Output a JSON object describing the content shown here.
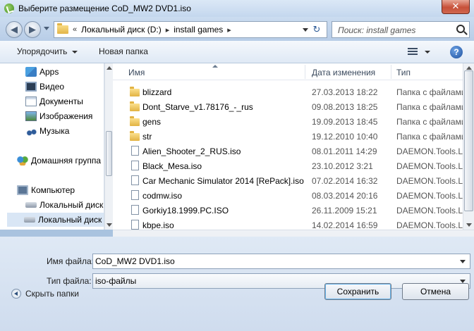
{
  "window": {
    "title": "Выберите размещение CoD_MW2 DVD1.iso",
    "close_glyph": "✕"
  },
  "nav_buttons": {
    "back": "◀",
    "forward": "▶"
  },
  "address": {
    "prefix": "«",
    "crumbs": [
      "Локальный диск (D:)",
      "install games"
    ],
    "separator": "▸",
    "refresh_glyph": "↻"
  },
  "search": {
    "placeholder": "Поиск: install games"
  },
  "toolbar": {
    "organize": "Упорядочить",
    "new_folder": "Новая папка",
    "help": "?"
  },
  "nav_pane": {
    "items": [
      {
        "label": "Apps",
        "icon": "apps-icon"
      },
      {
        "label": "Видео",
        "icon": "video-icon"
      },
      {
        "label": "Документы",
        "icon": "documents-icon"
      },
      {
        "label": "Изображения",
        "icon": "images-icon"
      },
      {
        "label": "Музыка",
        "icon": "music-icon"
      }
    ],
    "homegroup": "Домашняя группа",
    "computer": "Компьютер",
    "disks": [
      "Локальный диск",
      "Локальный диск"
    ]
  },
  "file_list": {
    "columns": {
      "name": "Имя",
      "date": "Дата изменения",
      "type": "Тип"
    },
    "rows": [
      {
        "name": "blizzard",
        "date": "27.03.2013 18:22",
        "type": "Папка с файлами",
        "kind": "folder"
      },
      {
        "name": "Dont_Starve_v1.78176_-_rus",
        "date": "09.08.2013 18:25",
        "type": "Папка с файлами",
        "kind": "folder"
      },
      {
        "name": "gens",
        "date": "19.09.2013 18:45",
        "type": "Папка с файлами",
        "kind": "folder"
      },
      {
        "name": "str",
        "date": "19.12.2010 10:40",
        "type": "Папка с файлами",
        "kind": "folder"
      },
      {
        "name": "Alien_Shooter_2_RUS.iso",
        "date": "08.01.2011 14:29",
        "type": "DAEMON.Tools.L",
        "kind": "file"
      },
      {
        "name": "Black_Mesa.iso",
        "date": "23.10.2012 3:21",
        "type": "DAEMON.Tools.L",
        "kind": "file"
      },
      {
        "name": "Car Mechanic Simulator 2014 [RePack].iso",
        "date": "07.02.2014 16:32",
        "type": "DAEMON.Tools.L",
        "kind": "file"
      },
      {
        "name": "codmw.iso",
        "date": "08.03.2014 20:16",
        "type": "DAEMON.Tools.L",
        "kind": "file"
      },
      {
        "name": "Gorkiy18.1999.PC.ISO",
        "date": "26.11.2009 15:21",
        "type": "DAEMON.Tools.L",
        "kind": "file"
      },
      {
        "name": "kbpe.iso",
        "date": "14.02.2014 16:59",
        "type": "DAEMON.Tools.L",
        "kind": "file"
      }
    ]
  },
  "bottom": {
    "filename_label": "Имя файла:",
    "filename_value": "CoD_MW2 DVD1.iso",
    "filetype_label": "Тип файла:",
    "filetype_value": "iso-файлы",
    "hide_folders": "Скрыть папки",
    "save": "Сохранить",
    "cancel": "Отмена"
  }
}
